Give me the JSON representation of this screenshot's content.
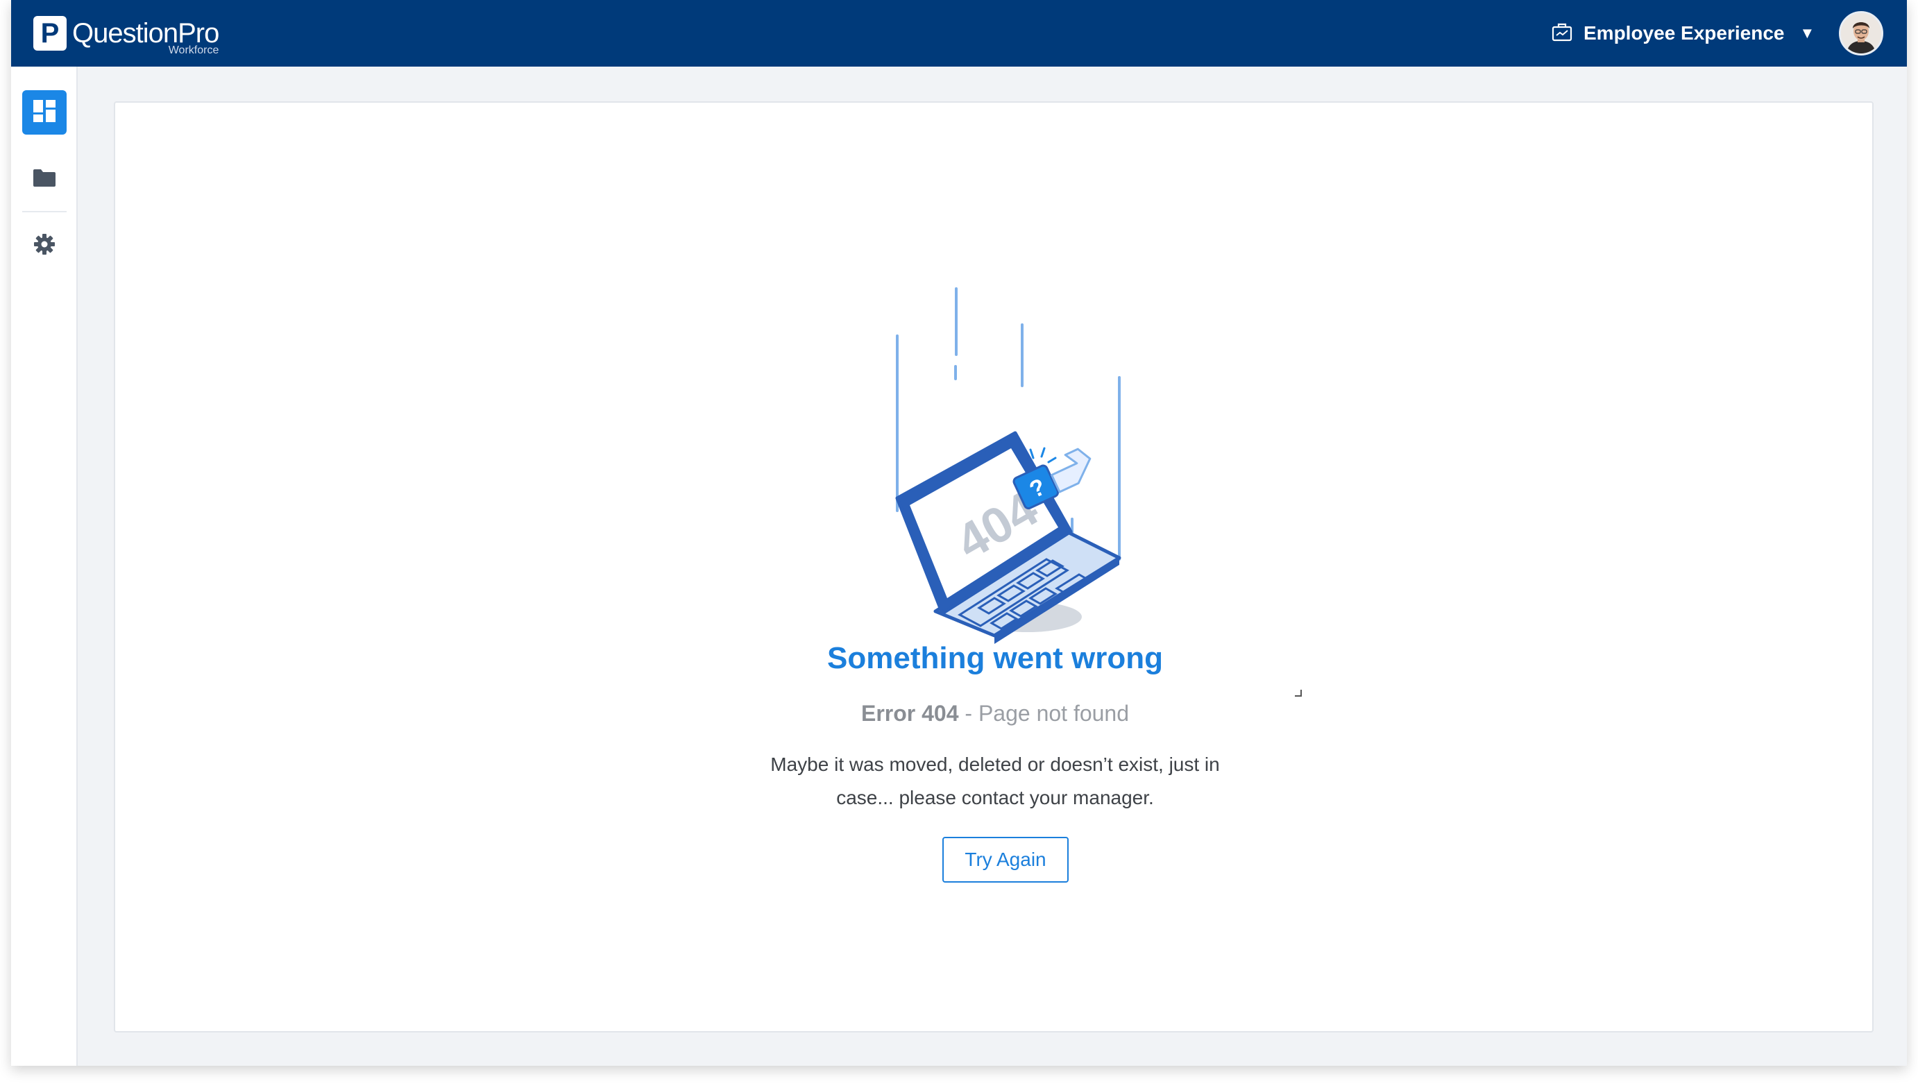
{
  "brand": {
    "logo_letter": "P",
    "name": "QuestionPro",
    "sub": "Workforce"
  },
  "topbar": {
    "workspace_label": "Employee Experience",
    "workspace_icon": "briefcase-chart-icon",
    "dropdown_icon": "caret-down-icon"
  },
  "sidebar": {
    "items": [
      {
        "name": "dashboard",
        "icon": "dashboard-icon",
        "active": true
      },
      {
        "name": "folders",
        "icon": "folder-icon",
        "active": false
      },
      {
        "name": "settings",
        "icon": "gear-icon",
        "active": false
      }
    ]
  },
  "error_page": {
    "illustration_text": "404",
    "title": "Something went wrong",
    "error_code": "Error 404",
    "error_separator": " - ",
    "error_text": "Page not found",
    "message": "Maybe it was moved, deleted or doesn’t exist, just in case... please contact your manager.",
    "button_label": "Try Again"
  },
  "colors": {
    "topbar": "#003a7a",
    "accent": "#1b87e6",
    "title": "#1b7fdc"
  }
}
